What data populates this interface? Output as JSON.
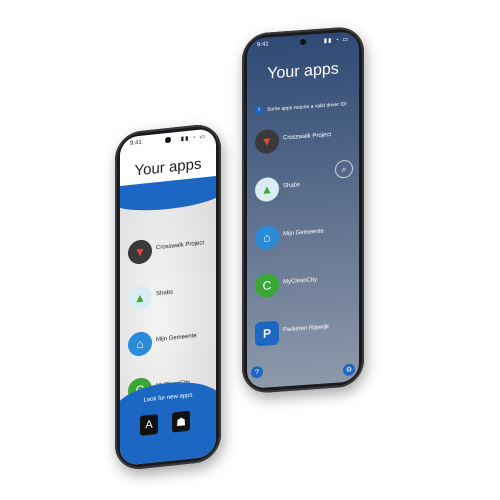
{
  "left_phone": {
    "status": {
      "time": "9:41",
      "signal": "▮▮ ◔ ▭"
    },
    "title": "Your apps",
    "apps": [
      {
        "label": "Crosswalk Project",
        "icon": "crosswalk-icon",
        "color": "#3a3a3a",
        "glyph": "▼"
      },
      {
        "label": "Shabs",
        "icon": "shabs-icon",
        "color": "#cfe8f0",
        "glyph": "▲"
      },
      {
        "label": "Mijn Gemeente",
        "icon": "municipality-icon",
        "color": "#2a8bd8",
        "glyph": "⌂"
      },
      {
        "label": "MyCleanCity",
        "icon": "cleancity-icon",
        "color": "#3aa635",
        "glyph": "C"
      }
    ],
    "footer_label": "Look for new apps",
    "store_icons": [
      "app-store-icon",
      "android-icon"
    ]
  },
  "right_phone": {
    "status": {
      "time": "9:41",
      "signal": "▮▮ ◔ ▭"
    },
    "title": "Your apps",
    "notice": "Some apps require a valid driver ID!",
    "apps": [
      {
        "label": "Crosswalk Project",
        "icon": "crosswalk-icon",
        "color": "#3a3a3a",
        "glyph": "▼"
      },
      {
        "label": "Shabs",
        "icon": "shabs-icon",
        "color": "#cfe8f0",
        "glyph": "▲"
      },
      {
        "label": "Mijn Gemeente",
        "icon": "municipality-icon",
        "color": "#2a8bd8",
        "glyph": "⌂"
      },
      {
        "label": "MyCleanCity",
        "icon": "cleancity-icon",
        "color": "#3aa635",
        "glyph": "C"
      },
      {
        "label": "Parkeren Rijswijk",
        "icon": "parking-icon",
        "color": "#1c67c3",
        "glyph": "P"
      }
    ]
  },
  "colors": {
    "accent": "#1c67c3",
    "dark_bg": "#2e4a74"
  }
}
